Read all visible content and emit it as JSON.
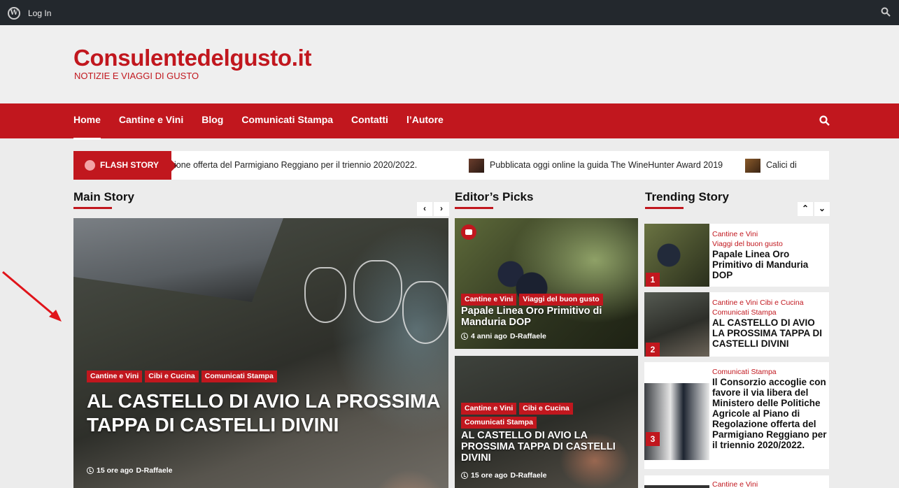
{
  "adminbar": {
    "login_label": "Log In"
  },
  "site": {
    "title": "Consulentedelgusto.it",
    "tagline": "NOTIZIE E VIAGGI DI GUSTO"
  },
  "nav": {
    "items": [
      "Home",
      "Cantine e Vini",
      "Blog",
      "Comunicati Stampa",
      "Contatti",
      "l’Autore"
    ]
  },
  "ticker": {
    "label": "FLASH STORY",
    "items": [
      "ione offerta del Parmigiano Reggiano per il triennio 2020/2022.",
      "Pubblicata oggi online la guida The WineHunter Award 2019",
      "Calici di"
    ]
  },
  "sections": {
    "main": "Main Story",
    "editors": "Editor’s Picks",
    "trending": "Trending Story"
  },
  "main_story": {
    "tags": [
      "Cantine e Vini",
      "Cibi e Cucina",
      "Comunicati Stampa"
    ],
    "title": "AL CASTELLO DI AVIO LA PROSSIMA TAPPA DI CASTELLI DIVINI",
    "time": "15 ore ago",
    "author": "D-Raffaele"
  },
  "editors_picks": [
    {
      "tags": [
        "Cantine e Vini",
        "Viaggi del buon gusto"
      ],
      "title": "Papale Linea Oro Primitivo di Manduria DOP",
      "time": "4 anni ago",
      "author": "D-Raffaele"
    },
    {
      "tags": [
        "Cantine e Vini",
        "Cibi e Cucina",
        "Comunicati Stampa"
      ],
      "title": "AL CASTELLO DI AVIO LA PROSSIMA TAPPA DI CASTELLI DIVINI",
      "time": "15 ore ago",
      "author": "D-Raffaele"
    }
  ],
  "trending": [
    {
      "num": "1",
      "cats": [
        "Cantine e Vini",
        "Viaggi del buon gusto"
      ],
      "title": "Papale Linea Oro Primitivo di Manduria DOP"
    },
    {
      "num": "2",
      "cats": [
        "Cantine e Vini",
        "Cibi e Cucina",
        "Comunicati Stampa"
      ],
      "title": "AL CASTELLO DI AVIO LA PROSSIMA TAPPA DI CASTELLI DIVINI"
    },
    {
      "num": "3",
      "cats": [
        "Comunicati Stampa"
      ],
      "title": "Il Consorzio accoglie con favore il via libera del Ministero delle Politiche Agricole al Piano di Regolazione offerta del Parmigiano Reggiano per il triennio 2020/2022."
    },
    {
      "num": "",
      "cats": [
        "Cantine e Vini"
      ],
      "title": ""
    }
  ],
  "colors": {
    "brand": "#c1171e",
    "adminbar": "#23282d"
  },
  "icons": [
    "wordpress-icon",
    "search-icon",
    "chevron-left-icon",
    "chevron-right-icon",
    "chevron-up-icon",
    "chevron-down-icon",
    "camera-icon",
    "clock-icon"
  ]
}
